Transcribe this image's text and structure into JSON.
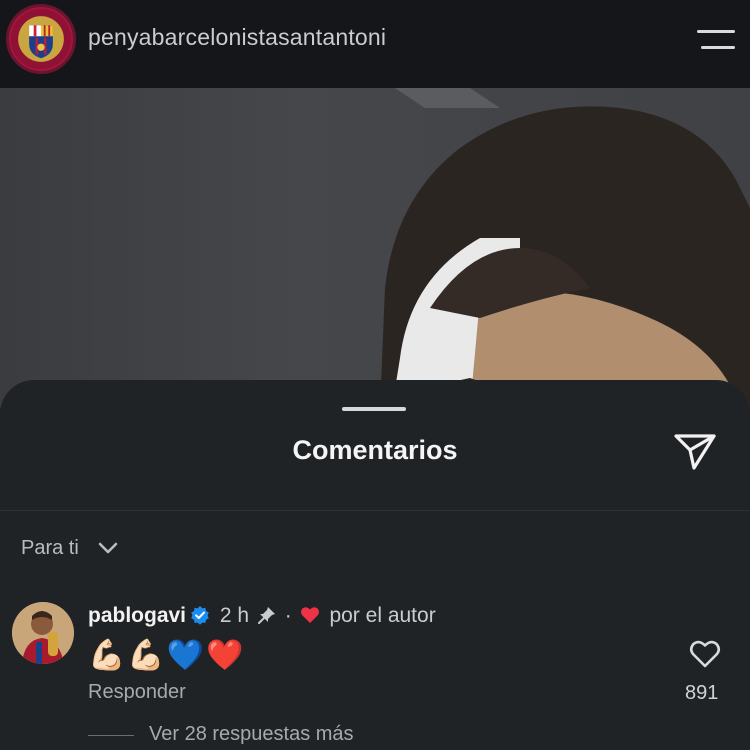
{
  "header": {
    "account_name": "penyabarcelonistasantantoni"
  },
  "comments_sheet": {
    "title": "Comentarios",
    "filter_label": "Para ti",
    "comment": {
      "username": "pablogavi",
      "time": "2 h",
      "separator": "·",
      "liked_by_author": "por el autor",
      "text": "💪🏻💪🏻💙❤️",
      "reply_label": "Responder",
      "like_count": "891",
      "view_more_replies": "Ver 28 respuestas más"
    }
  },
  "icons": {
    "menu": "hamburger-menu-icon",
    "send": "send-paper-plane-icon",
    "chevron": "chevron-down-icon",
    "verified": "verified-badge-icon",
    "pin": "pin-icon",
    "heart": "heart-icon"
  },
  "colors": {
    "verified_blue": "#1d8cf0",
    "author_like_red": "#ef3346",
    "sheet_bg": "#202326"
  }
}
